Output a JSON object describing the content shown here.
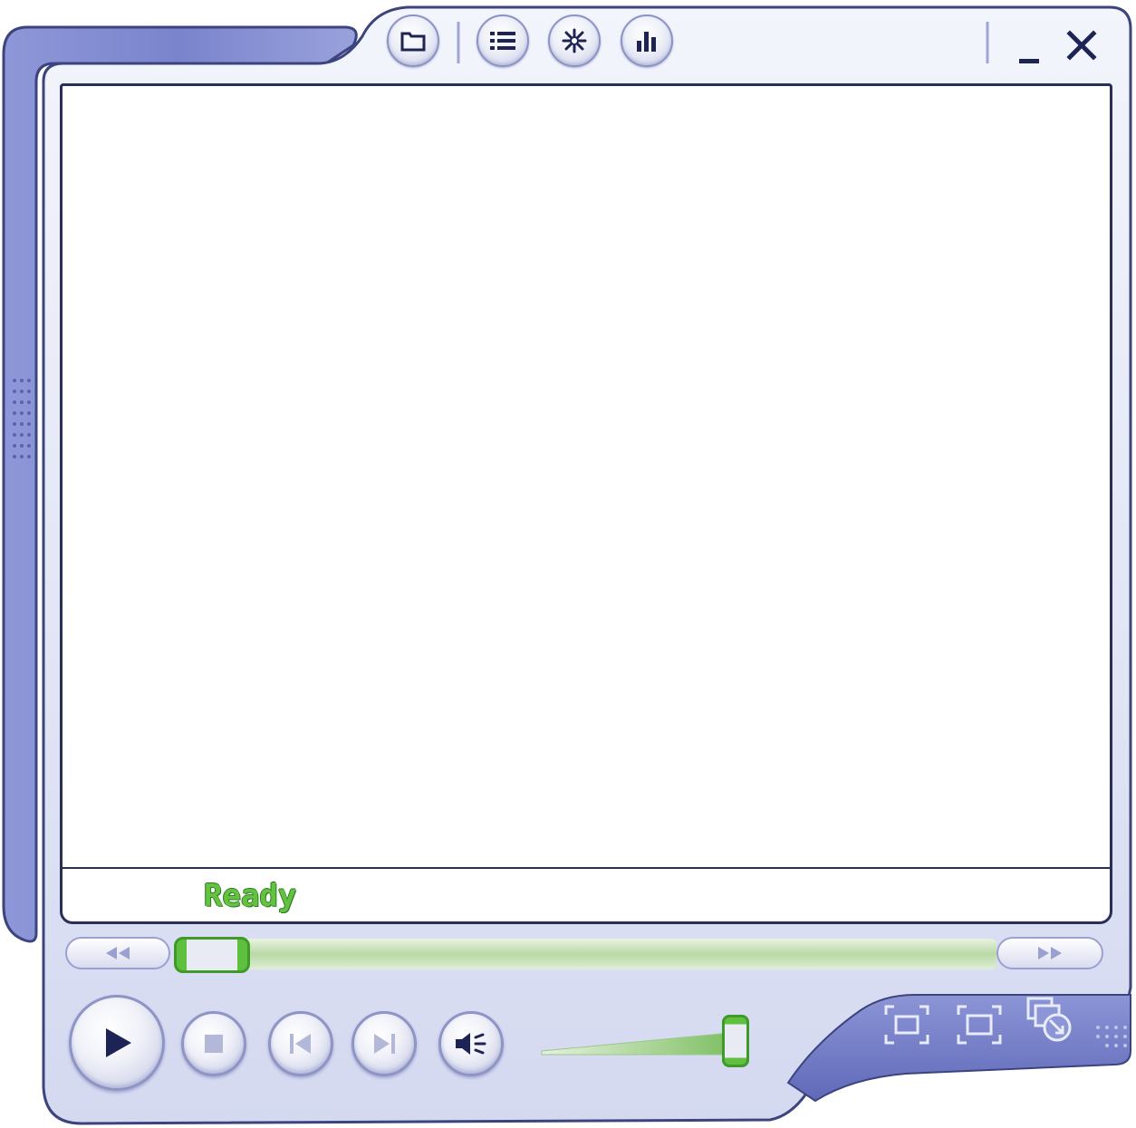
{
  "player": {
    "status_text": "Ready"
  },
  "colors": {
    "frame_blue": "#7b84cc",
    "frame_light": "#dfe3f5",
    "accent_green": "#63c23f",
    "outline_dark": "#2a2f5a"
  },
  "title_bar_icons": [
    "folder-icon",
    "playlist-icon",
    "visualization-icon",
    "equalizer-icon"
  ],
  "window_controls": [
    "minimize-icon",
    "close-icon"
  ],
  "transport_icons": [
    "play-icon",
    "stop-icon",
    "previous-icon",
    "next-icon",
    "mute-icon"
  ],
  "view_icons": [
    "fullscreen-icon",
    "compact-view-icon",
    "skin-mode-icon"
  ],
  "seek": {
    "position_fraction": 0.0
  },
  "volume": {
    "level_fraction": 1.0
  }
}
